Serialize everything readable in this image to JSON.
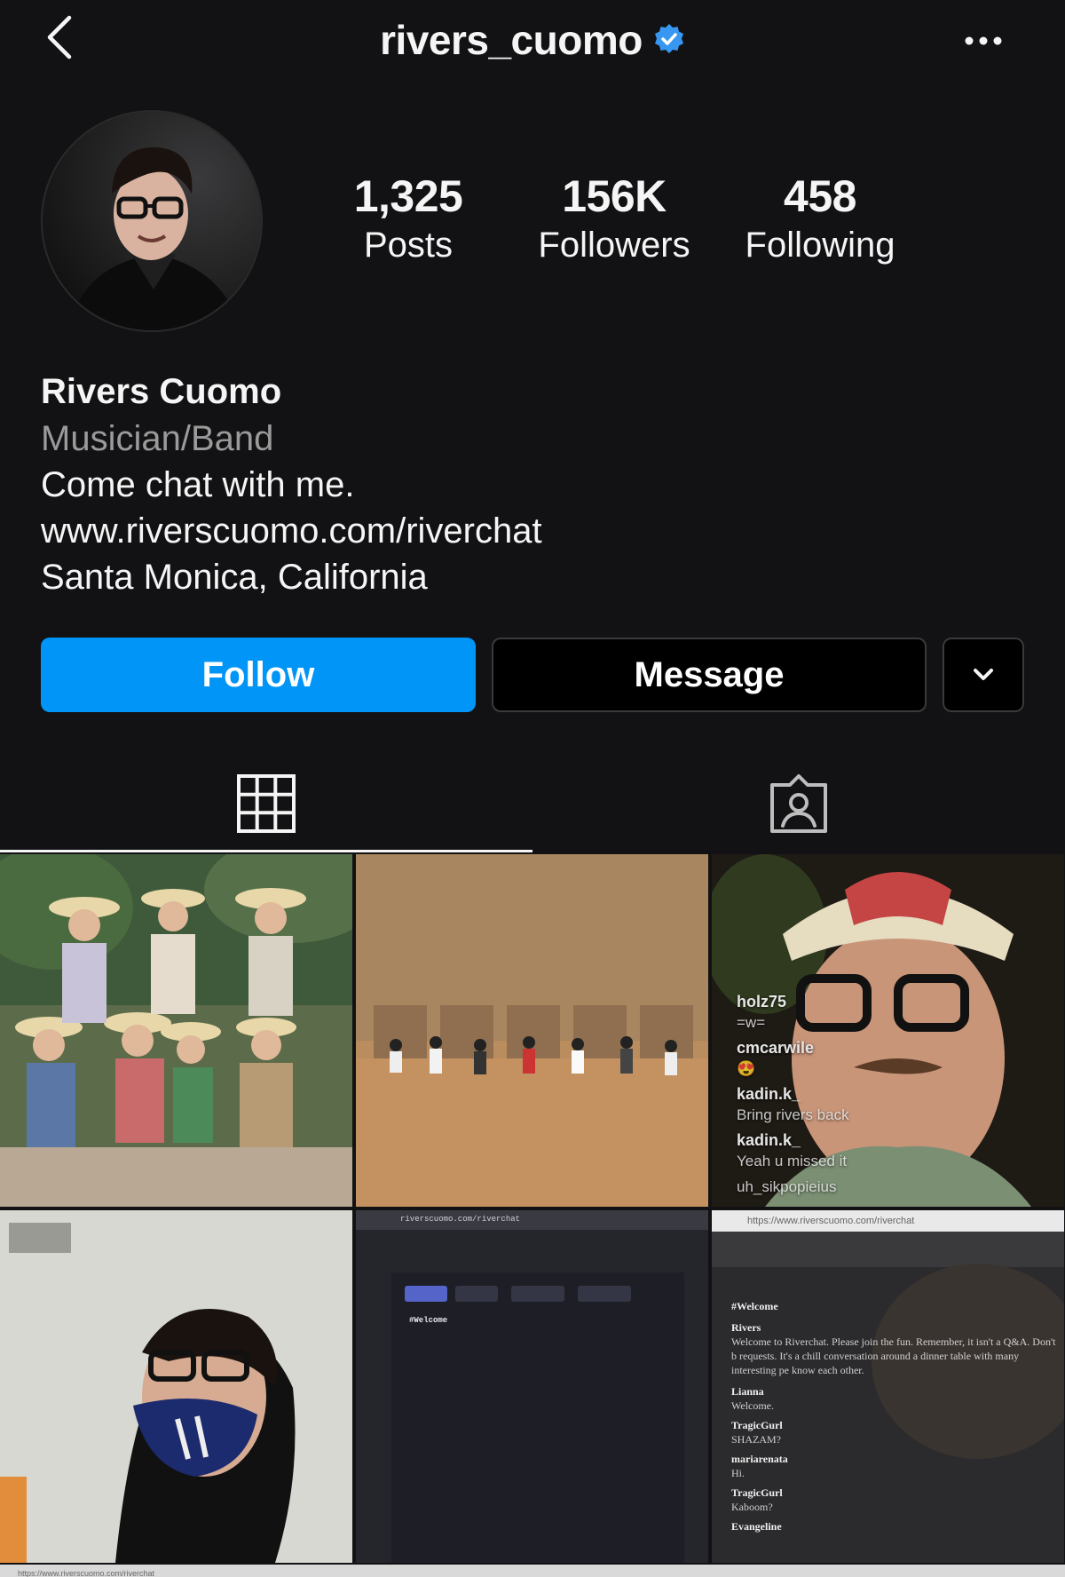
{
  "header": {
    "username": "rivers_cuomo",
    "back_icon": "chevron-left-icon",
    "verified_icon": "verified-badge-icon",
    "more_icon": "more-horizontal-icon"
  },
  "profile": {
    "avatar_icon": "profile-avatar"
  },
  "stats": [
    {
      "value": "1,325",
      "label": "Posts"
    },
    {
      "value": "156K",
      "label": "Followers"
    },
    {
      "value": "458",
      "label": "Following"
    }
  ],
  "bio": {
    "name": "Rivers Cuomo",
    "category": "Musician/Band",
    "text": "Come chat with me.",
    "link": "www.riverscuomo.com/riverchat",
    "location": "Santa Monica, California"
  },
  "actions": {
    "follow_label": "Follow",
    "message_label": "Message",
    "dropdown_icon": "chevron-down-icon"
  },
  "tabs": [
    {
      "icon": "grid-icon",
      "active": true
    },
    {
      "icon": "tagged-icon",
      "active": false
    }
  ],
  "posts": {
    "live_comments": [
      {
        "user": "holz75",
        "message": "=w="
      },
      {
        "user": "cmcarwile",
        "message": "😍"
      },
      {
        "user": "kadin.k_",
        "message": "Bring rivers back"
      },
      {
        "user": "kadin.k_",
        "message": "Yeah u missed it"
      },
      {
        "user": "uh_sikpopieius",
        "message": ""
      }
    ],
    "chat_url_1": "riverscuomo.com/riverchat",
    "chat_url_2": "https://www.riverscuomo.com/riverchat",
    "chat_welcome": "#Welcome",
    "chat_user": "Rivers",
    "chat_message": "Welcome to Riverchat. Please join the fun. Remember, it isn't a Q&A. Don't b requests. It's a chill conversation around a dinner table with many interesting pe know each other.",
    "chat_lines": [
      {
        "user": "Lianna",
        "message": "Welcome."
      },
      {
        "user": "TragicGurl",
        "message": "SHAZAM?"
      },
      {
        "user": "mariarenata",
        "message": "Hi."
      },
      {
        "user": "TragicGurl",
        "message": "Kaboom?"
      },
      {
        "user": "Evangeline",
        "message": ""
      }
    ],
    "bottom_url": "https://www.riverscuomo.com/riverchat"
  },
  "colors": {
    "background": "#121214",
    "accent": "#0095f6",
    "verified": "#3897f0",
    "muted_text": "#9a9a9a"
  }
}
